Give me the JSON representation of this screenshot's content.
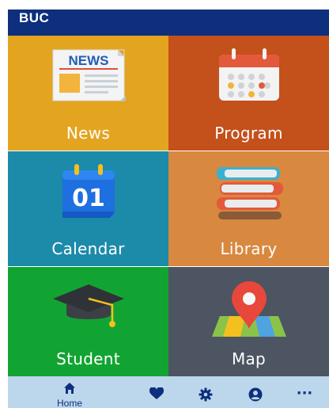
{
  "app": {
    "title": "BUC"
  },
  "tiles": [
    {
      "label": "News",
      "icon": "newspaper-icon"
    },
    {
      "label": "Program",
      "icon": "calendar-schedule-icon"
    },
    {
      "label": "Calendar",
      "icon": "calendar-date-icon",
      "badge": "01"
    },
    {
      "label": "Library",
      "icon": "books-icon"
    },
    {
      "label": "Student",
      "icon": "graduation-cap-icon"
    },
    {
      "label": "Map",
      "icon": "map-pin-icon"
    }
  ],
  "news_icon_text": "NEWS",
  "bottom_nav": {
    "items": [
      {
        "icon": "home-icon",
        "label": "Home",
        "active": true
      },
      {
        "icon": "heart-icon"
      },
      {
        "icon": "gear-icon"
      },
      {
        "icon": "account-icon"
      },
      {
        "icon": "more-icon",
        "glyph": "···"
      }
    ]
  },
  "colors": {
    "appbar": "#0e2f7e",
    "news": "#e3a420",
    "program": "#c4501c",
    "calendar": "#1c8aa9",
    "library": "#d9883f",
    "student": "#12a432",
    "map": "#4c5561",
    "bottom_nav": "#bcd7ec"
  }
}
